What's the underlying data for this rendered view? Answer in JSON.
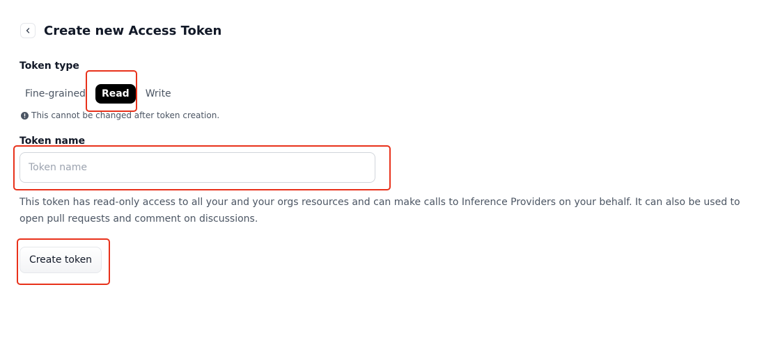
{
  "header": {
    "title": "Create new Access Token"
  },
  "token_type": {
    "label": "Token type",
    "options": [
      {
        "label": "Fine-grained",
        "selected": false
      },
      {
        "label": "Read",
        "selected": true
      },
      {
        "label": "Write",
        "selected": false
      }
    ],
    "notice": "This cannot be changed after token creation."
  },
  "token_name": {
    "label": "Token name",
    "placeholder": "Token name",
    "value": ""
  },
  "description": "This token has read-only access to all your and your orgs resources and can make calls to Inference Providers on your behalf. It can also be used to open pull requests and comment on discussions.",
  "actions": {
    "create_label": "Create token"
  },
  "colors": {
    "highlight": "#e8311a",
    "active_tab": "#000000"
  },
  "icons": {
    "back": "chevron-left-icon",
    "notice": "info-circle-icon"
  }
}
